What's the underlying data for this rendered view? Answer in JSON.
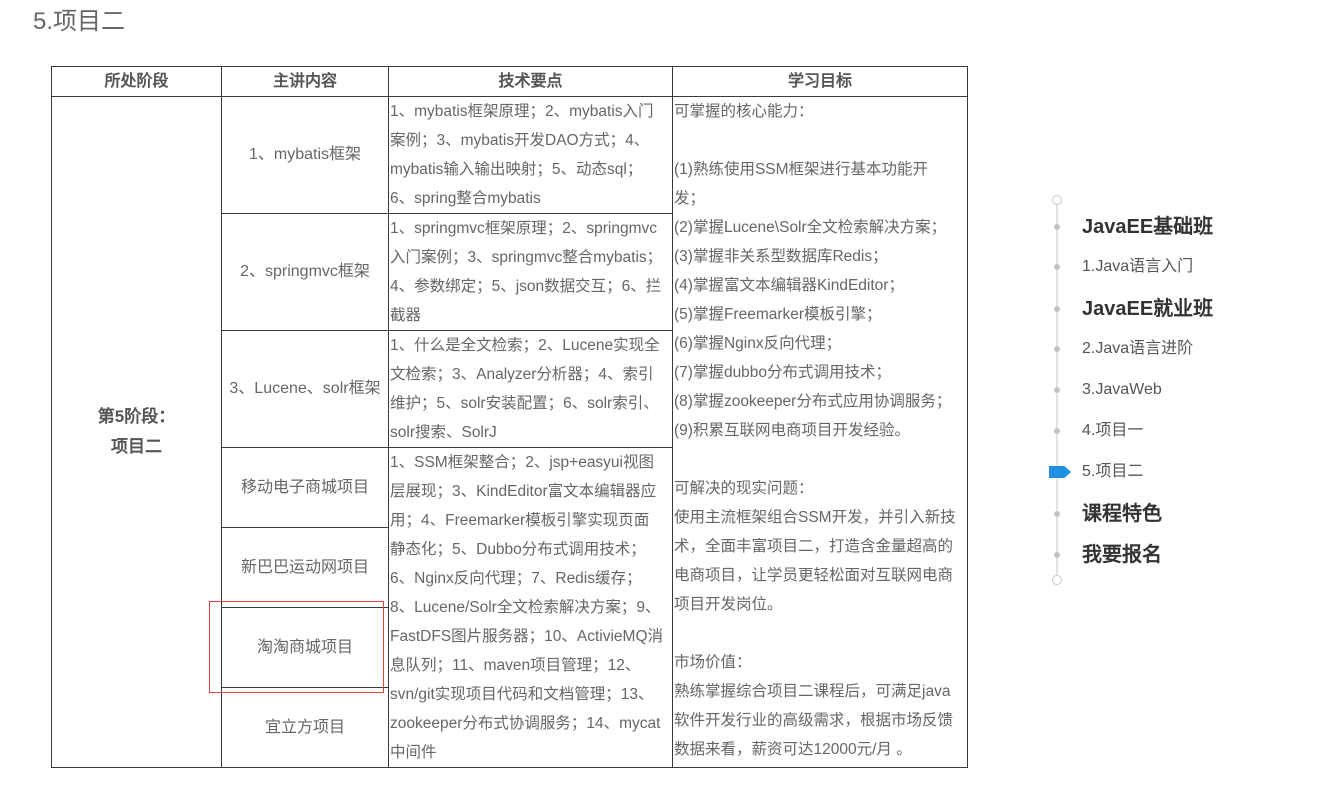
{
  "page_title": "5.项目二",
  "table": {
    "headers": {
      "stage": "所处阶段",
      "topic": "主讲内容",
      "tech": "技术要点",
      "goal": "学习目标"
    },
    "stage": [
      "第5阶段：",
      "项目二"
    ],
    "topics": [
      "1、mybatis框架",
      "2、springmvc框架",
      "3、Lucene、solr框架",
      "移动电子商城项目",
      "新巴巴运动网项目",
      "淘淘商城项目",
      "宜立方项目"
    ],
    "tech_points": [
      [
        "1、mybatis框架原理；2、mybatis入门",
        "案例；3、mybatis开发DAO方式；4、",
        "mybatis输入输出映射；5、动态sql；",
        "6、spring整合mybatis"
      ],
      [
        "1、springmvc框架原理；2、springmvc",
        "入门案例；3、springmvc整合mybatis；",
        "4、参数绑定；5、json数据交互；6、拦",
        "截器"
      ],
      [
        "1、什么是全文检索；2、Lucene实现全",
        "文检索；3、Analyzer分析器；4、索引",
        "维护；5、solr安装配置；6、solr索引、",
        "solr搜索、SolrJ"
      ],
      [
        "1、SSM框架整合；2、jsp+easyui视图",
        "层展现；3、KindEditor富文本编辑器应",
        "用；4、Freemarker模板引擎实现页面",
        "静态化；5、Dubbo分布式调用技术；",
        "6、Nginx反向代理；7、Redis缓存；",
        "8、Lucene/Solr全文检索解决方案；9、",
        "FastDFS图片服务器；10、ActivieMQ消",
        "息队列；11、maven项目管理；12、",
        "svn/git实现项目代码和文档管理；13、",
        "zookeeper分布式协调服务；14、mycat",
        "中间件"
      ]
    ],
    "goals": {
      "core_title": "可掌握的核心能力：",
      "core_lines": [
        "(1)熟练使用SSM框架进行基本功能开",
        "发；",
        "(2)掌握Lucene\\Solr全文检索解决方案；",
        "(3)掌握非关系型数据库Redis；",
        "(4)掌握富文本编辑器KindEditor；",
        "(5)掌握Freemarker模板引擎；",
        "(6)掌握Nginx反向代理；",
        "(7)掌握dubbo分布式调用技术；",
        "(8)掌握zookeeper分布式应用协调服务；",
        "(9)积累互联网电商项目开发经验。"
      ],
      "problems_title": "可解决的现实问题：",
      "problems_lines": [
        "使用主流框架组合SSM开发，并引入新技",
        "术，全面丰富项目二，打造含金量超高的",
        "电商项目，让学员更轻松面对互联网电商",
        "项目开发岗位。"
      ],
      "value_title": "市场价值：",
      "value_lines": [
        "熟练掌握综合项目二课程后，可满足java",
        "软件开发行业的高级需求，根据市场反馈",
        "数据来看，薪资可达12000元/月 。"
      ]
    }
  },
  "nav": {
    "items": [
      {
        "label": "JavaEE基础班",
        "heading": true
      },
      {
        "label": "1.Java语言入门",
        "heading": false
      },
      {
        "label": "JavaEE就业班",
        "heading": true
      },
      {
        "label": "2.Java语言进阶",
        "heading": false
      },
      {
        "label": "3.JavaWeb",
        "heading": false
      },
      {
        "label": "4.项目一",
        "heading": false
      },
      {
        "label": "5.项目二",
        "heading": false,
        "active": true
      },
      {
        "label": "课程特色",
        "heading": true
      },
      {
        "label": "我要报名",
        "heading": true
      }
    ]
  },
  "colors": {
    "accent": "#1e8fe1",
    "highlight_border": "#e0443c",
    "table_border": "#3a3a3a"
  }
}
